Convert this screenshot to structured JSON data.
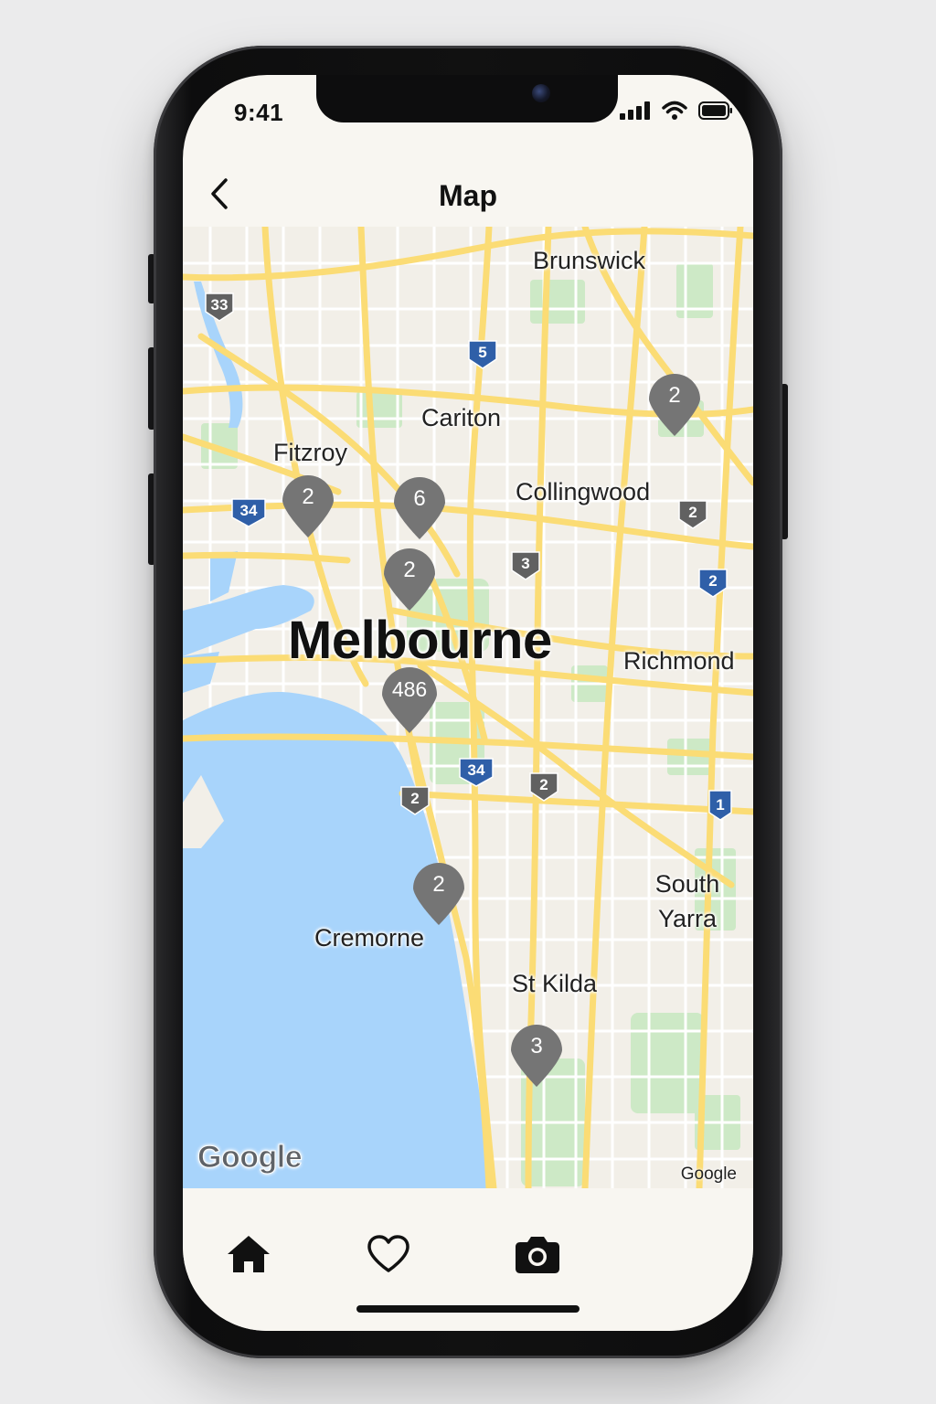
{
  "status_bar": {
    "time": "9:41"
  },
  "header": {
    "title": "Map"
  },
  "map": {
    "labels": {
      "brunswick": "Brunswick",
      "carlton": "Cariton",
      "fitzroy": "Fitzroy",
      "collingwood": "Collingwood",
      "melbourne": "Melbourne",
      "richmond": "Richmond",
      "south_yarra_1": "South",
      "south_yarra_2": "Yarra",
      "cremorne": "Cremorne",
      "st_kilda": "St Kilda"
    },
    "clusters": {
      "northeast": "2",
      "fitzroy": "2",
      "carlton": "6",
      "cbd": "2",
      "southbank": "486",
      "cremorne": "2",
      "st_kilda": "3"
    },
    "route_shields": {
      "r33": "33",
      "r5": "5",
      "r34_west": "34",
      "r2_collingwood": "2",
      "r3": "3",
      "r2_east": "2",
      "r34_south": "34",
      "r2_south_west": "2",
      "r2_south_mid": "2",
      "r1": "1"
    },
    "attribution": {
      "logo": "Google",
      "credit": "Google"
    },
    "colors": {
      "water": "#a8d4fb",
      "land": "#f2efe8",
      "roads": "#fbdc75",
      "parks": "#cde9c6",
      "cluster": "#757575"
    }
  },
  "tabbar": {
    "icons": [
      "home-icon",
      "heart-icon",
      "camera-icon"
    ]
  }
}
